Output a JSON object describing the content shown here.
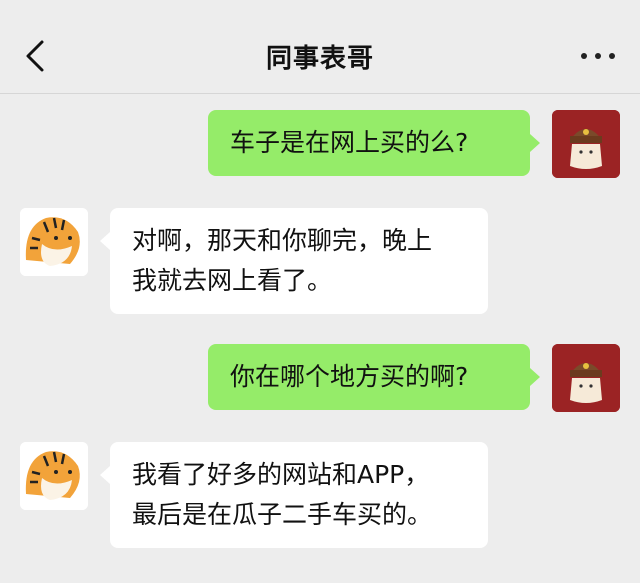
{
  "header": {
    "title": "同事表哥",
    "back_icon": "chevron-left-icon",
    "more_icon": "more-dots-icon"
  },
  "colors": {
    "background": "#ededed",
    "my_bubble": "#95ec69",
    "other_bubble": "#ffffff"
  },
  "messages": [
    {
      "sender": "me",
      "lines": [
        "车子是在网上买的么?"
      ]
    },
    {
      "sender": "other",
      "lines": [
        "对啊，那天和你聊完，晚上",
        "我就去网上看了。"
      ]
    },
    {
      "sender": "me",
      "lines": [
        "你在哪个地方买的啊?"
      ]
    },
    {
      "sender": "other",
      "lines": [
        "我看了好多的网站和APP，",
        "最后是在瓜子二手车买的。"
      ]
    }
  ]
}
